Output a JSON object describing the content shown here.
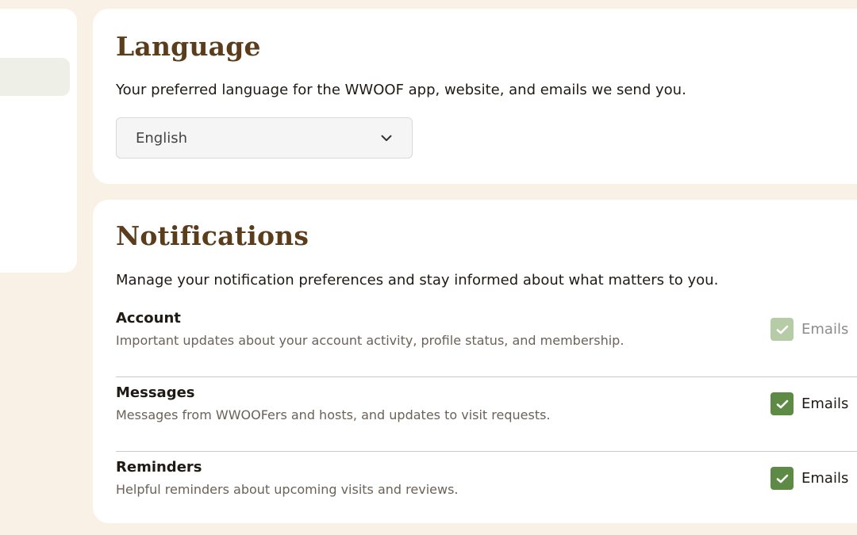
{
  "colors": {
    "page_background": "#f9f1e6",
    "card_background": "#ffffff",
    "heading_brown": "#5b3d1c",
    "checkbox_green": "#5d8a44",
    "checkbox_disabled_green": "#b6cca6"
  },
  "language": {
    "title": "Language",
    "description": "Your preferred language for the WWOOF app, website, and emails we send you.",
    "select_value": "English",
    "select_icon": "chevron-down-icon"
  },
  "notifications": {
    "title": "Notifications",
    "description": "Manage your notification preferences and stay informed about what matters to you.",
    "items": [
      {
        "title": "Account",
        "subtitle": "Important updates about your account activity, profile status, and membership.",
        "toggle_label": "Emails",
        "checked": true,
        "disabled": true
      },
      {
        "title": "Messages",
        "subtitle": "Messages from WWOOFers and hosts, and updates to visit requests.",
        "toggle_label": "Emails",
        "checked": true,
        "disabled": false
      },
      {
        "title": "Reminders",
        "subtitle": "Helpful reminders about upcoming visits and reviews.",
        "toggle_label": "Emails",
        "checked": true,
        "disabled": false
      }
    ]
  }
}
